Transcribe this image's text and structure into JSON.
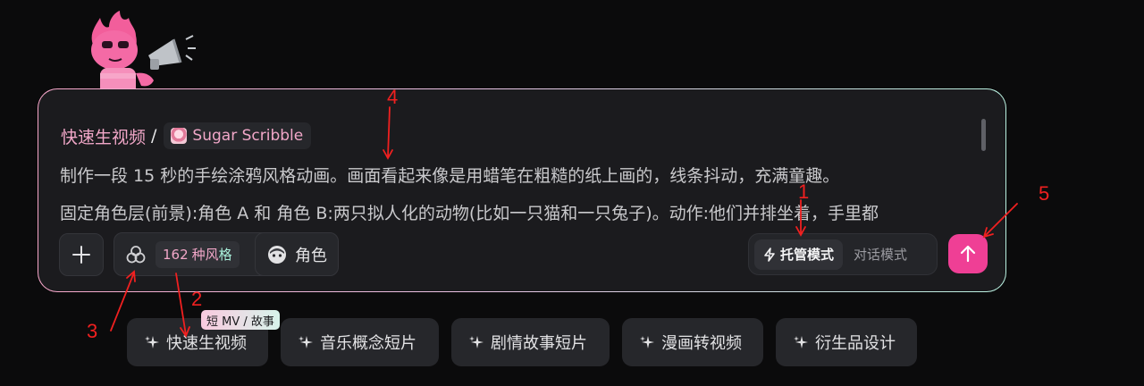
{
  "colors": {
    "accent": "#ef3f95",
    "pink_text": "#f1a7c8",
    "mint_text": "#a9f0da",
    "annotation": "#f02020"
  },
  "composer": {
    "breadcrumb_title": "快速生视频",
    "breadcrumb_sep": "/",
    "style_chip": {
      "label": "Sugar Scribble",
      "icon": "style-thumbnail"
    },
    "prompt_lines": [
      "制作一段 15 秒的手绘涂鸦风格动画。画面看起来像是用蜡笔在粗糙的纸上画的，线条抖动，充满童趣。",
      "固定角色层(前景):角色 A 和 角色 B:两只拟人化的动物(比如一只猫和一只兔子)。动作:他们并排坐着，手里都"
    ],
    "toolbar": {
      "add_icon": "plus-icon",
      "styles_icon": "three-circles-icon",
      "styles_count": "162",
      "styles_word1": "种风",
      "styles_word2": "格",
      "role_icon": "face-icon",
      "role_label": "角色",
      "mode_active": "托管模式",
      "mode_active_icon": "lightning-icon",
      "mode_inactive": "对话模式",
      "send_icon": "arrow-up-icon"
    }
  },
  "suggestions": [
    {
      "label": "快速生视频",
      "icon": "sparkle-icon"
    },
    {
      "label": "音乐概念短片",
      "icon": "sparkle-icon"
    },
    {
      "label": "剧情故事短片",
      "icon": "sparkle-icon"
    },
    {
      "label": "漫画转视频",
      "icon": "sparkle-icon"
    },
    {
      "label": "衍生品设计",
      "icon": "sparkle-icon"
    }
  ],
  "suggestion_badge": "短 MV / 故事",
  "annotations": [
    "1",
    "2",
    "3",
    "4",
    "5"
  ]
}
